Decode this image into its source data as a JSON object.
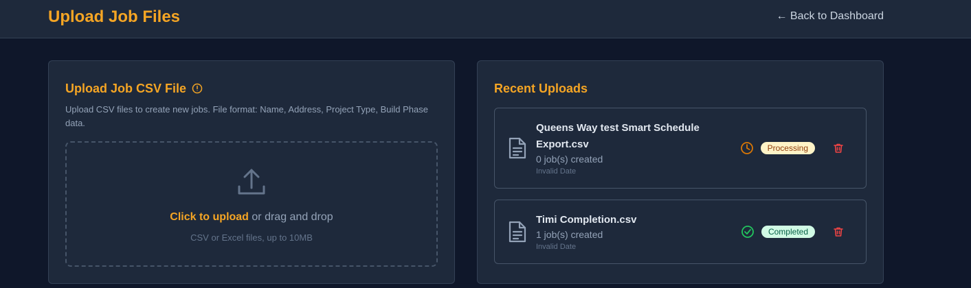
{
  "header": {
    "title": "Upload Job Files",
    "back_link": "← Back to Dashboard"
  },
  "upload_panel": {
    "heading": "Upload Job CSV File",
    "description": "Upload CSV files to create new jobs. File format: Name, Address, Project Type, Build Phase data.",
    "dropzone": {
      "click_text": "Click to upload",
      "rest_text": " or drag and drop",
      "hint": "CSV or Excel files, up to 10MB"
    },
    "icons": {
      "info": "info-circle-icon",
      "upload": "upload-icon"
    }
  },
  "recent_panel": {
    "heading": "Recent Uploads",
    "uploads": [
      {
        "name": "Queens Way test Smart Schedule Export.csv",
        "jobs": "0 job(s) created",
        "date": "Invalid Date",
        "status": "Processing",
        "status_icon": "clock-icon",
        "status_color": "#d97706"
      },
      {
        "name": "Timi Completion.csv",
        "jobs": "1 job(s) created",
        "date": "Invalid Date",
        "status": "Completed",
        "status_icon": "check-circle-icon",
        "status_color": "#22c55e"
      }
    ]
  },
  "colors": {
    "accent": "#f5a524",
    "background": "#0f172a",
    "panel": "#1e293b",
    "delete": "#ef4444"
  }
}
